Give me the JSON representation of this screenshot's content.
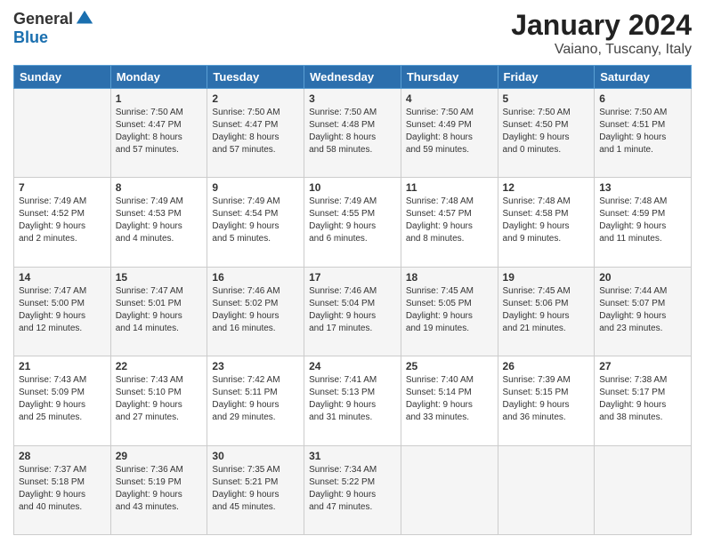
{
  "logo": {
    "general": "General",
    "blue": "Blue"
  },
  "header": {
    "month": "January 2024",
    "location": "Vaiano, Tuscany, Italy"
  },
  "weekdays": [
    "Sunday",
    "Monday",
    "Tuesday",
    "Wednesday",
    "Thursday",
    "Friday",
    "Saturday"
  ],
  "weeks": [
    [
      {
        "day": "",
        "info": ""
      },
      {
        "day": "1",
        "info": "Sunrise: 7:50 AM\nSunset: 4:47 PM\nDaylight: 8 hours\nand 57 minutes."
      },
      {
        "day": "2",
        "info": "Sunrise: 7:50 AM\nSunset: 4:47 PM\nDaylight: 8 hours\nand 57 minutes."
      },
      {
        "day": "3",
        "info": "Sunrise: 7:50 AM\nSunset: 4:48 PM\nDaylight: 8 hours\nand 58 minutes."
      },
      {
        "day": "4",
        "info": "Sunrise: 7:50 AM\nSunset: 4:49 PM\nDaylight: 8 hours\nand 59 minutes."
      },
      {
        "day": "5",
        "info": "Sunrise: 7:50 AM\nSunset: 4:50 PM\nDaylight: 9 hours\nand 0 minutes."
      },
      {
        "day": "6",
        "info": "Sunrise: 7:50 AM\nSunset: 4:51 PM\nDaylight: 9 hours\nand 1 minute."
      }
    ],
    [
      {
        "day": "7",
        "info": "Sunrise: 7:49 AM\nSunset: 4:52 PM\nDaylight: 9 hours\nand 2 minutes."
      },
      {
        "day": "8",
        "info": "Sunrise: 7:49 AM\nSunset: 4:53 PM\nDaylight: 9 hours\nand 4 minutes."
      },
      {
        "day": "9",
        "info": "Sunrise: 7:49 AM\nSunset: 4:54 PM\nDaylight: 9 hours\nand 5 minutes."
      },
      {
        "day": "10",
        "info": "Sunrise: 7:49 AM\nSunset: 4:55 PM\nDaylight: 9 hours\nand 6 minutes."
      },
      {
        "day": "11",
        "info": "Sunrise: 7:48 AM\nSunset: 4:57 PM\nDaylight: 9 hours\nand 8 minutes."
      },
      {
        "day": "12",
        "info": "Sunrise: 7:48 AM\nSunset: 4:58 PM\nDaylight: 9 hours\nand 9 minutes."
      },
      {
        "day": "13",
        "info": "Sunrise: 7:48 AM\nSunset: 4:59 PM\nDaylight: 9 hours\nand 11 minutes."
      }
    ],
    [
      {
        "day": "14",
        "info": "Sunrise: 7:47 AM\nSunset: 5:00 PM\nDaylight: 9 hours\nand 12 minutes."
      },
      {
        "day": "15",
        "info": "Sunrise: 7:47 AM\nSunset: 5:01 PM\nDaylight: 9 hours\nand 14 minutes."
      },
      {
        "day": "16",
        "info": "Sunrise: 7:46 AM\nSunset: 5:02 PM\nDaylight: 9 hours\nand 16 minutes."
      },
      {
        "day": "17",
        "info": "Sunrise: 7:46 AM\nSunset: 5:04 PM\nDaylight: 9 hours\nand 17 minutes."
      },
      {
        "day": "18",
        "info": "Sunrise: 7:45 AM\nSunset: 5:05 PM\nDaylight: 9 hours\nand 19 minutes."
      },
      {
        "day": "19",
        "info": "Sunrise: 7:45 AM\nSunset: 5:06 PM\nDaylight: 9 hours\nand 21 minutes."
      },
      {
        "day": "20",
        "info": "Sunrise: 7:44 AM\nSunset: 5:07 PM\nDaylight: 9 hours\nand 23 minutes."
      }
    ],
    [
      {
        "day": "21",
        "info": "Sunrise: 7:43 AM\nSunset: 5:09 PM\nDaylight: 9 hours\nand 25 minutes."
      },
      {
        "day": "22",
        "info": "Sunrise: 7:43 AM\nSunset: 5:10 PM\nDaylight: 9 hours\nand 27 minutes."
      },
      {
        "day": "23",
        "info": "Sunrise: 7:42 AM\nSunset: 5:11 PM\nDaylight: 9 hours\nand 29 minutes."
      },
      {
        "day": "24",
        "info": "Sunrise: 7:41 AM\nSunset: 5:13 PM\nDaylight: 9 hours\nand 31 minutes."
      },
      {
        "day": "25",
        "info": "Sunrise: 7:40 AM\nSunset: 5:14 PM\nDaylight: 9 hours\nand 33 minutes."
      },
      {
        "day": "26",
        "info": "Sunrise: 7:39 AM\nSunset: 5:15 PM\nDaylight: 9 hours\nand 36 minutes."
      },
      {
        "day": "27",
        "info": "Sunrise: 7:38 AM\nSunset: 5:17 PM\nDaylight: 9 hours\nand 38 minutes."
      }
    ],
    [
      {
        "day": "28",
        "info": "Sunrise: 7:37 AM\nSunset: 5:18 PM\nDaylight: 9 hours\nand 40 minutes."
      },
      {
        "day": "29",
        "info": "Sunrise: 7:36 AM\nSunset: 5:19 PM\nDaylight: 9 hours\nand 43 minutes."
      },
      {
        "day": "30",
        "info": "Sunrise: 7:35 AM\nSunset: 5:21 PM\nDaylight: 9 hours\nand 45 minutes."
      },
      {
        "day": "31",
        "info": "Sunrise: 7:34 AM\nSunset: 5:22 PM\nDaylight: 9 hours\nand 47 minutes."
      },
      {
        "day": "",
        "info": ""
      },
      {
        "day": "",
        "info": ""
      },
      {
        "day": "",
        "info": ""
      }
    ]
  ]
}
